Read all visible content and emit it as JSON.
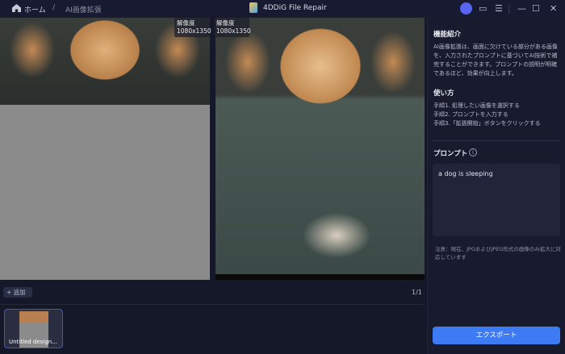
{
  "titlebar": {
    "home": "ホーム",
    "separator": "/",
    "current": "AI画像拡張",
    "app_title": "4DDiG File Repair"
  },
  "images": {
    "left_res_label": "解像度",
    "left_res": "1080x1350",
    "right_res_label": "解像度",
    "right_res": "1080x1350"
  },
  "sidebar": {
    "intro_title": "機能紹介",
    "intro_text": "AI画像拡張は、画面に欠けている部分がある画像を、入力されたプロンプトに基づいてAI技術で補完することができます。プロンプトの説明が明確であるほど、効果が向上します。",
    "howto_title": "使い方",
    "steps": [
      "手順1. 処理したい画像を選択する",
      "手順2. プロンプトを入力する",
      "手順3.「拡張開始」ボタンをクリックする"
    ],
    "prompt_title": "プロンプト",
    "prompt_value": "a dog is sleeping",
    "note": "注意：現在、JPGおよびJPEG形式の画像のみ拡大に対応しています",
    "export_label": "エクスポート"
  },
  "bottom": {
    "add_label": "+ 追加",
    "pager": "1/1",
    "thumb_label": "Untitled design..."
  }
}
